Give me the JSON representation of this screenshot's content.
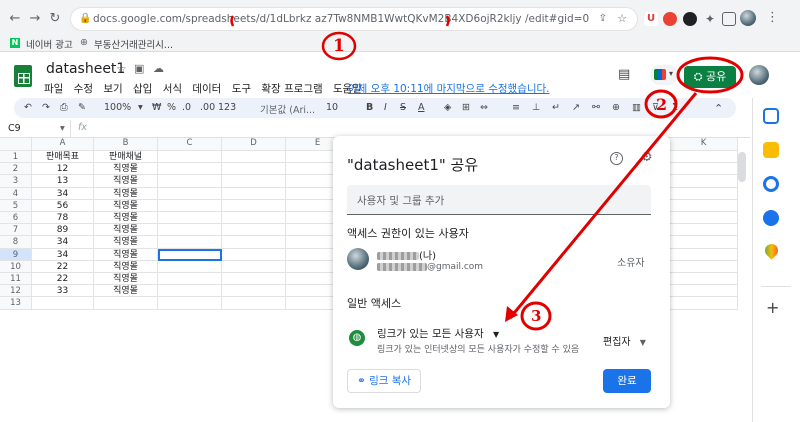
{
  "browser": {
    "url": "docs.google.com/spreadsheets/d/1dLbrkz  az7Tw8NMB1WwtQKvM2B4XD6ojR2kljy  /edit#gid=0",
    "bookmarks": [
      "네이버 광고",
      "부동산거래관리시..."
    ]
  },
  "sheets": {
    "title": "datasheet1",
    "menus": [
      "파일",
      "수정",
      "보기",
      "삽입",
      "서식",
      "데이터",
      "도구",
      "확장 프로그램",
      "도움말"
    ],
    "last_edit": "어제 오후 10:11에 마지막으로 수정했습니다.",
    "share_label": "공유"
  },
  "toolbar": {
    "zoom": "100%",
    "currency": "₩",
    "percent": "%",
    "dec_dec": ".0",
    "dec_inc": ".00",
    "number_fmt": "123",
    "font": "기본값 (Ari...",
    "size": "10"
  },
  "formula_bar": {
    "cell_ref": "C9",
    "fx": "fx"
  },
  "grid": {
    "columns": [
      "A",
      "B",
      "C",
      "D",
      "E",
      "K"
    ],
    "rows": [
      {
        "n": "1",
        "a": "판매목표",
        "b": "판매채널"
      },
      {
        "n": "2",
        "a": "12",
        "b": "직영몰"
      },
      {
        "n": "3",
        "a": "13",
        "b": "직영몰"
      },
      {
        "n": "4",
        "a": "34",
        "b": "직영몰"
      },
      {
        "n": "5",
        "a": "56",
        "b": "직영몰"
      },
      {
        "n": "6",
        "a": "78",
        "b": "직영몰"
      },
      {
        "n": "7",
        "a": "89",
        "b": "직영몰"
      },
      {
        "n": "8",
        "a": "34",
        "b": "직영몰"
      },
      {
        "n": "9",
        "a": "34",
        "b": "직영몰"
      },
      {
        "n": "10",
        "a": "22",
        "b": "직영몰"
      },
      {
        "n": "11",
        "a": "22",
        "b": "직영몰"
      },
      {
        "n": "12",
        "a": "33",
        "b": "직영몰"
      },
      {
        "n": "13",
        "a": "",
        "b": ""
      }
    ]
  },
  "dialog": {
    "title": "\"datasheet1\" 공유",
    "add_placeholder": "사용자 및 그룹 추가",
    "access_heading": "액세스 권한이 있는 사용자",
    "owner_name_suffix": "(나)",
    "owner_email_suffix": "@gmail.com",
    "owner_role": "소유자",
    "general_heading": "일반 액세스",
    "link_setting": "링크가 있는 모든 사용자",
    "link_desc": "링크가 있는 인터넷상의 모든 사용자가 수정할 수 있음",
    "link_role": "편집자",
    "copy_link": "링크 복사",
    "done": "완료"
  },
  "annotations": [
    "1",
    "2",
    "3"
  ],
  "colors": {
    "share_green": "#0b8043",
    "blue": "#1a73e8",
    "annotation_red": "#e00000"
  }
}
